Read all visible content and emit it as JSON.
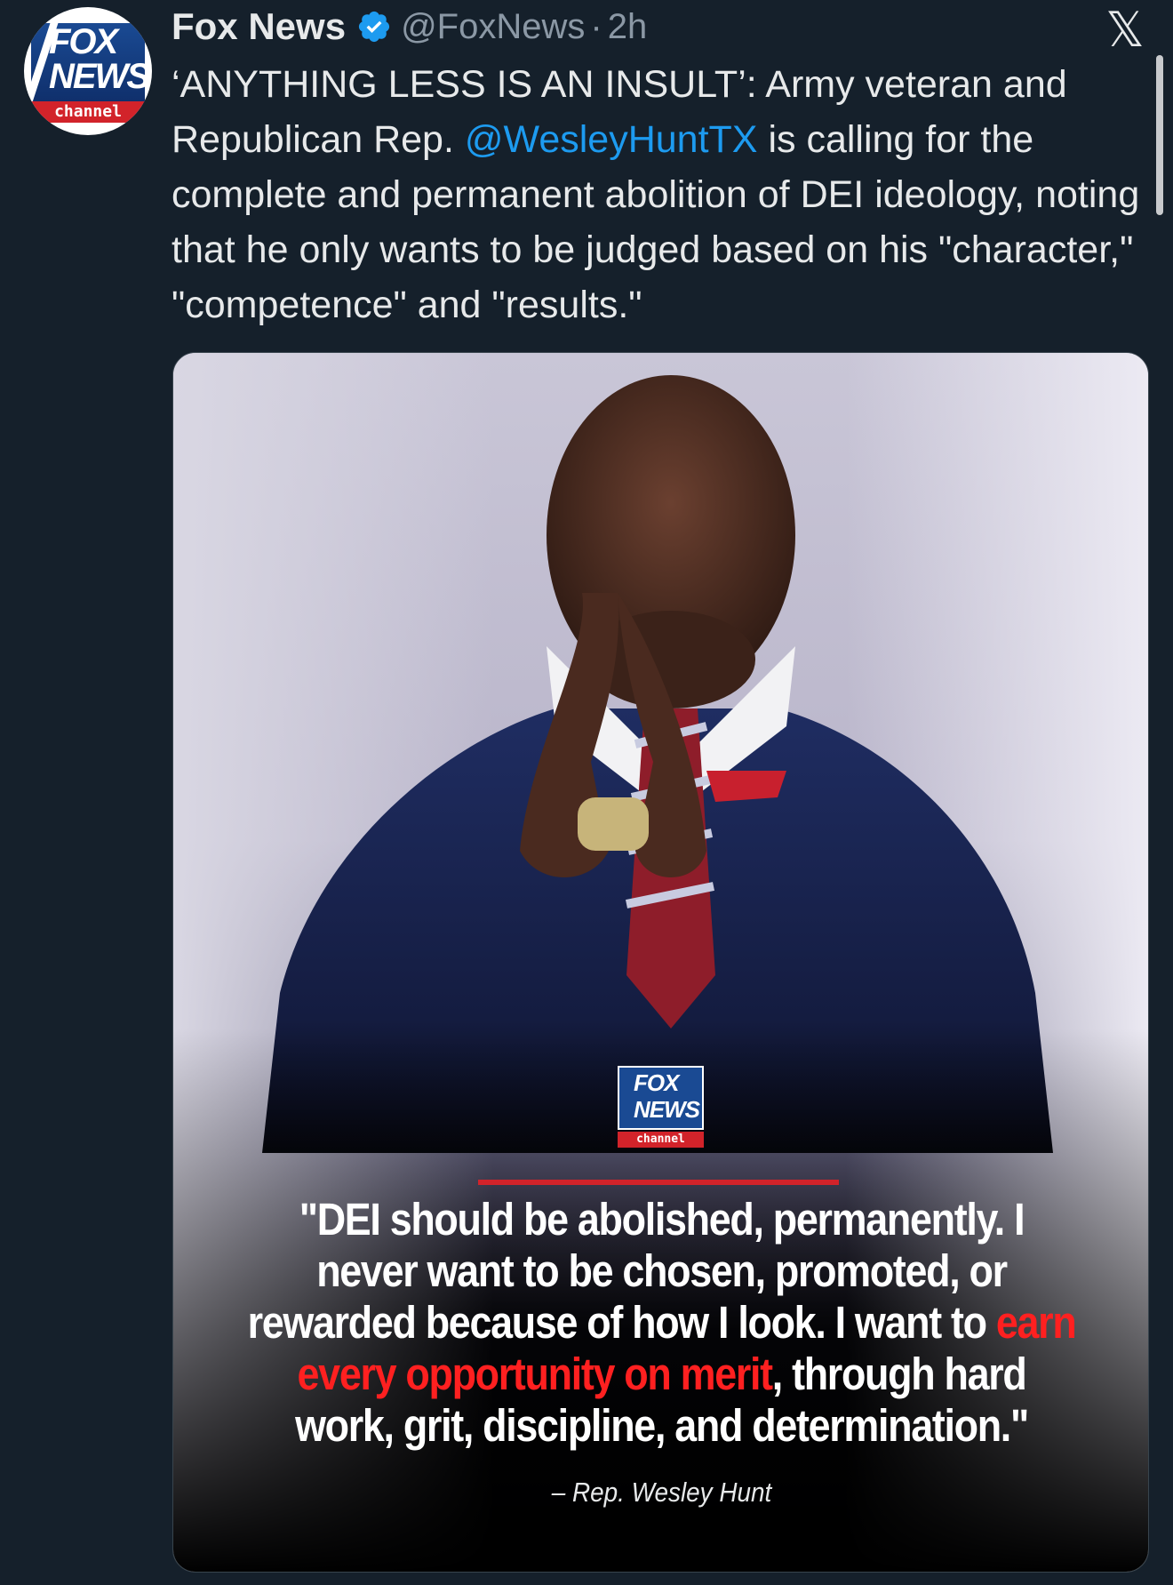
{
  "author": {
    "display_name": "Fox News",
    "handle": "@FoxNews",
    "separator": "·",
    "time": "2h",
    "avatar": {
      "logo_line1": "FOX",
      "logo_line2": "NEWS",
      "logo_line3": "channel"
    }
  },
  "tweet": {
    "text_part1": "‘ANYTHING LESS IS AN INSULT’: Army veteran and Republican Rep. ",
    "mention": "@WesleyHuntTX",
    "text_part2": " is calling for the complete and permanent abolition of DEI ideology, noting that he only wants to be judged based on his \"character,\" \"competence\" and \"results.\""
  },
  "media": {
    "logo_line1": "FOX",
    "logo_line2": "NEWS",
    "logo_line3": "channel",
    "quote_part1": "\"DEI should be abolished, permanently. I never want to be chosen, promoted, or rewarded because of how I look. I want to ",
    "quote_highlight": "earn every opportunity on merit",
    "quote_part2": ", through hard work, grit, discipline, and determination.\"",
    "attribution": "– Rep. Wesley Hunt"
  },
  "icons": {
    "verified": "verified-badge-icon",
    "platform": "x-logo-icon"
  },
  "colors": {
    "background": "#15202b",
    "mention": "#1d9bf0",
    "verified": "#1d9bf0",
    "highlight": "#ff2020",
    "brand_red": "#d2232a",
    "brand_blue": "#1a4a93"
  }
}
